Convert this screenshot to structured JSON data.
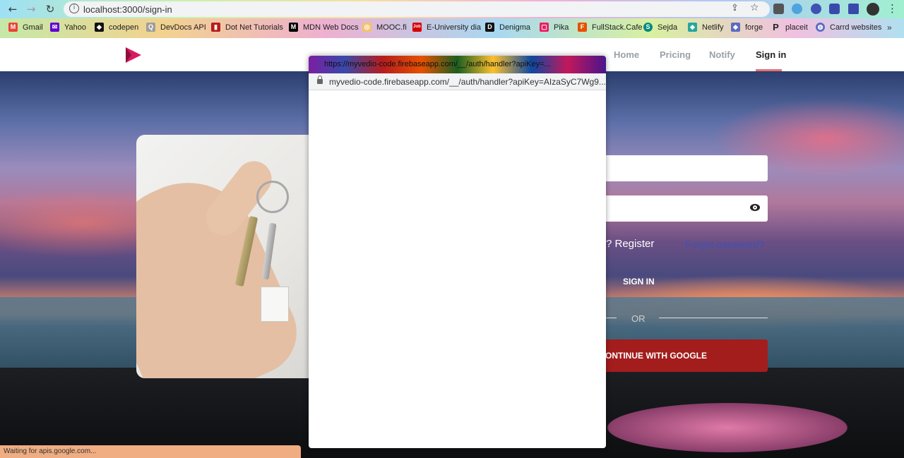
{
  "browser": {
    "back_icon": "←",
    "forward_icon": "→",
    "reload_icon": "↻",
    "url": "localhost:3000/sign-in",
    "more_icon": "⋮",
    "bookmarks": [
      {
        "label": "Gmail",
        "icon_text": "M",
        "color": "#ea4335"
      },
      {
        "label": "Yahoo",
        "icon_text": "✉",
        "color": "#6001d2"
      },
      {
        "label": "codepen",
        "icon_text": "◆",
        "color": "#111111"
      },
      {
        "label": "DevDocs API",
        "icon_text": "Q",
        "color": "#9e9e9e"
      },
      {
        "label": "Dot Net Tutorials",
        "icon_text": "▮",
        "color": "#b71c1c"
      },
      {
        "label": "MDN Web Docs",
        "icon_text": "M",
        "color": "#000000"
      },
      {
        "label": "MOOC.fi",
        "icon_text": "◎",
        "color": "#f5c26b"
      },
      {
        "label": "E-University dia",
        "icon_text": "Job",
        "color": "#d50000"
      },
      {
        "label": "Denigma",
        "icon_text": "D",
        "color": "#111111"
      },
      {
        "label": "Pika",
        "icon_text": "▢",
        "color": "#e91e63"
      },
      {
        "label": "FullStack.Cafe",
        "icon_text": "F",
        "color": "#e65100"
      },
      {
        "label": "Sejda",
        "icon_text": "S",
        "color": "#00897b"
      },
      {
        "label": "Netlify",
        "icon_text": "◈",
        "color": "#26a69a"
      },
      {
        "label": "forge",
        "icon_text": "◆",
        "color": "#5c6bc0"
      },
      {
        "label": "placeit",
        "icon_text": "P",
        "color": "#222222"
      },
      {
        "label": "Carrd websites",
        "icon_text": "◍",
        "color": "#5c6bc0"
      }
    ],
    "bookmarks_more": "»"
  },
  "site": {
    "nav": [
      {
        "label": "Home",
        "active": false
      },
      {
        "label": "Pricing",
        "active": false
      },
      {
        "label": "Notify",
        "active": false
      },
      {
        "label": "Sign in",
        "active": true
      }
    ]
  },
  "form": {
    "register_text": "? Register",
    "forgot_text": "Forgot password?",
    "signin_label": "SIGN IN",
    "or_label": "OR",
    "google_label": "ONTINUE WITH GOOGLE"
  },
  "popup": {
    "title": "https://myvedio-code.firebaseapp.com/__/auth/handler?apiKey=...",
    "url": "myvedio-code.firebaseapp.com/__/auth/handler?apiKey=AIzaSyC7Wg9..."
  },
  "status": {
    "text": "Waiting for apis.google.com..."
  }
}
